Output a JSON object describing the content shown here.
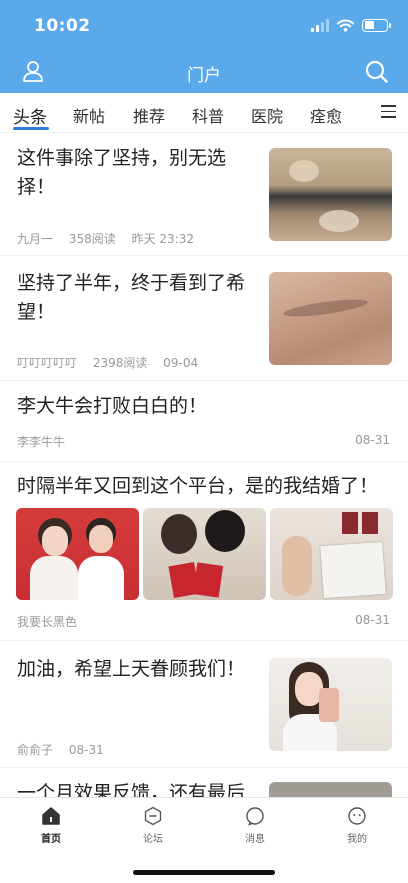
{
  "status": {
    "time": "10:02"
  },
  "nav": {
    "title": "门户"
  },
  "tabs": [
    {
      "label": "头条",
      "active": true
    },
    {
      "label": "新帖"
    },
    {
      "label": "推荐"
    },
    {
      "label": "科普"
    },
    {
      "label": "医院"
    },
    {
      "label": "痊愈"
    }
  ],
  "feed": [
    {
      "title": "这件事除了坚持，别无选择！",
      "author": "九月一",
      "reads": "358阅读",
      "time": "昨天 23:32"
    },
    {
      "title": "坚持了半年，终于看到了希望！",
      "author": "叮叮叮叮叮",
      "reads": "2398阅读",
      "time": "09-04"
    },
    {
      "title": "李大牛会打败白白的！",
      "author": "李李牛牛",
      "time": "08-31"
    },
    {
      "title": "时隔半年又回到这个平台，是的我结婚了！",
      "author": "我要长黑色",
      "time": "08-31"
    },
    {
      "title": "加油，希望上天眷顾我们！",
      "author": "俞俞子",
      "time": "08-31"
    },
    {
      "title": "一个月效果反馈，还有最后"
    }
  ],
  "tabbar": [
    {
      "label": "首页",
      "icon": "home-icon",
      "active": true
    },
    {
      "label": "论坛",
      "icon": "forum-icon"
    },
    {
      "label": "消息",
      "icon": "message-icon"
    },
    {
      "label": "我的",
      "icon": "profile-icon"
    }
  ],
  "colors": {
    "header": "#5aa9ea",
    "accent": "#2b7fd8"
  }
}
